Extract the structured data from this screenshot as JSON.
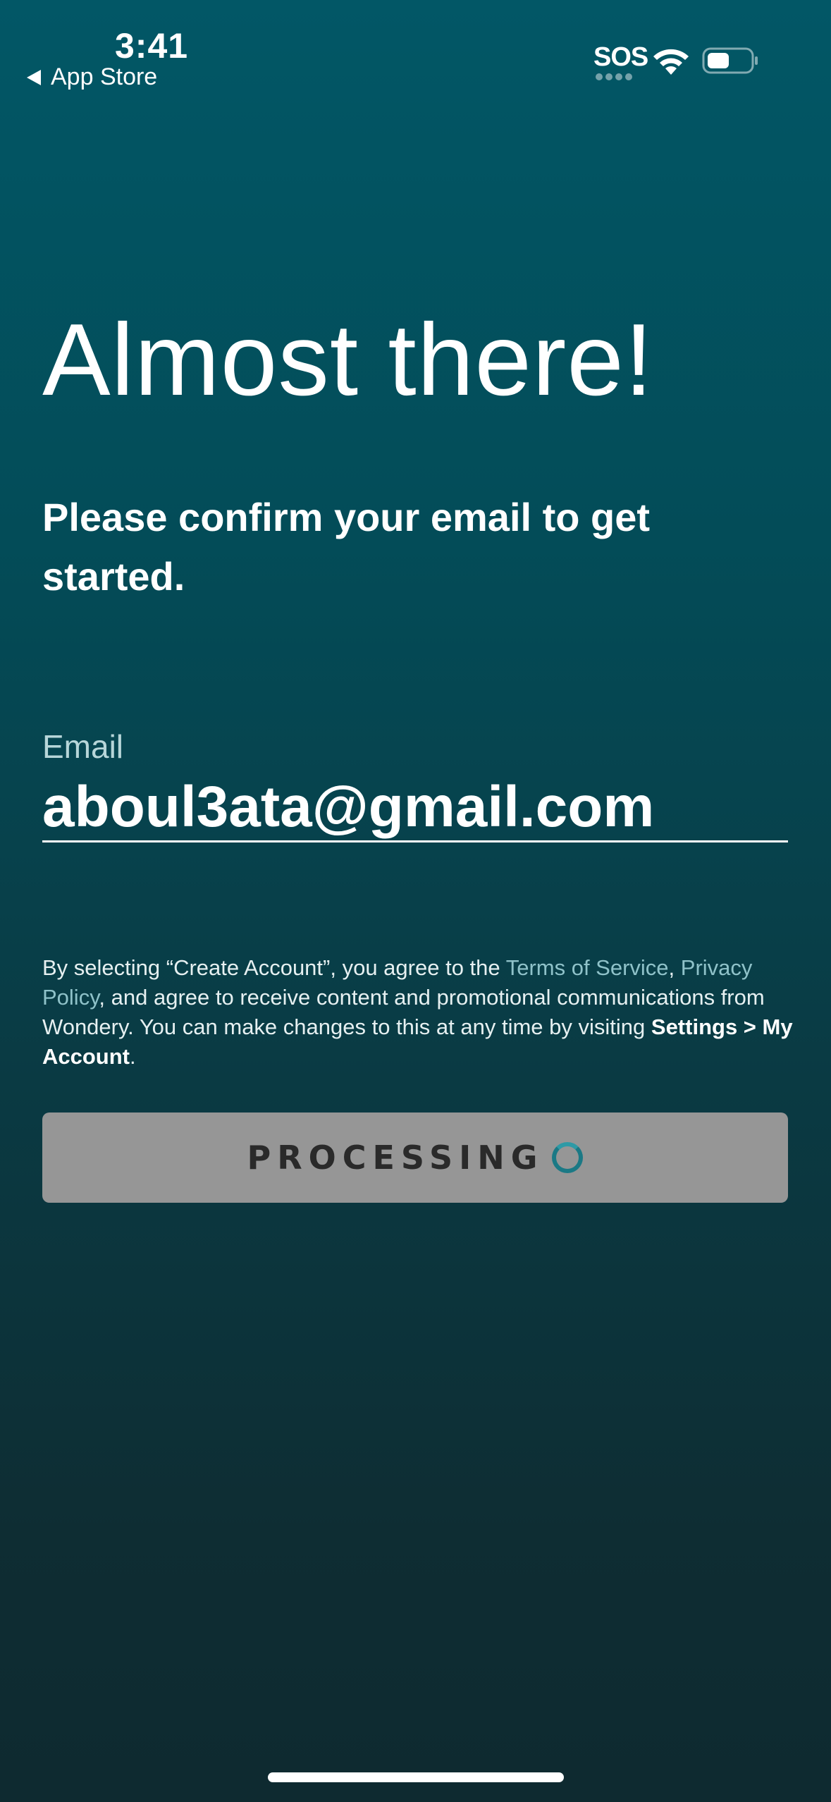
{
  "status_bar": {
    "time": "3:41",
    "back_label": "App Store",
    "sos": "SOS",
    "icons": [
      "wifi-icon",
      "battery-icon",
      "back-triangle-icon"
    ]
  },
  "page": {
    "heading": "Almost there!",
    "subheading": "Please confirm your email to get started."
  },
  "email": {
    "label": "Email",
    "value": "aboul3ata@gmail.com"
  },
  "legal": {
    "text_before": "By selecting “Create Account”, you agree to the ",
    "terms_link": "Terms of Service",
    "comma_sep": ", ",
    "privacy_link": "Privacy Policy",
    "text_middle": ", and agree to receive content and promotional communications from Wondery. You can make changes to this at any time by visiting ",
    "settings_path": "Settings > My Account",
    "text_end": "."
  },
  "button": {
    "label": "PROCESSING"
  },
  "colors": {
    "background_top": "#025766",
    "background_bottom": "#0e2a30",
    "link": "#8fc2c9",
    "button_bg": "#969696",
    "spinner": "#1b7985"
  }
}
